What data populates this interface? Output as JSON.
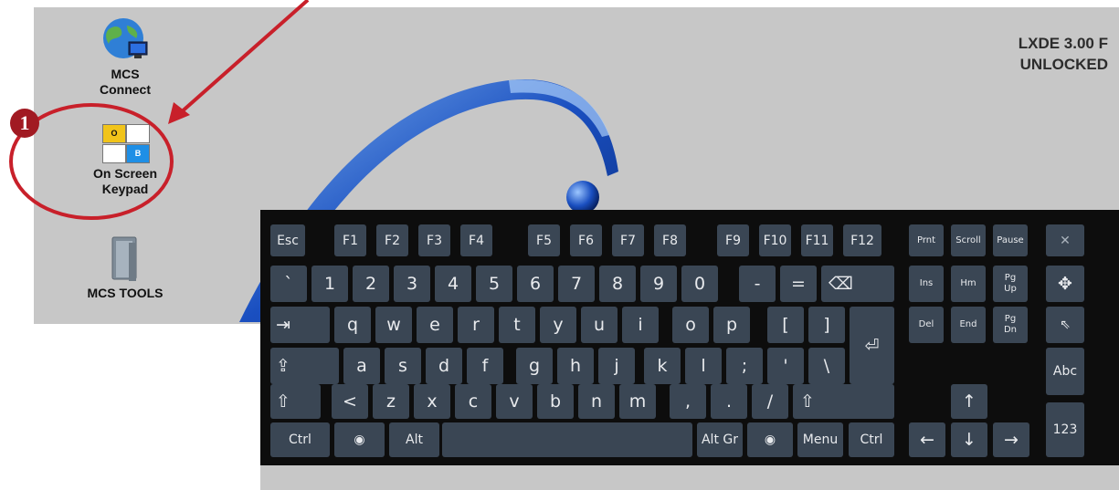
{
  "desktop": {
    "os_info": [
      "LXDE 3.00 F",
      "UNLOCKED"
    ],
    "icons": [
      {
        "id": "mcs-connect",
        "label_lines": [
          "MCS",
          "Connect"
        ],
        "icon": "globe-monitor-icon"
      },
      {
        "id": "on-screen-keypad",
        "label_lines": [
          "On Screen",
          "Keypad"
        ],
        "icon": "keypad-grid-icon",
        "grid_letters": [
          "O",
          "B"
        ]
      },
      {
        "id": "mcs-tools",
        "label_lines": [
          "MCS TOOLS"
        ],
        "icon": "folder-tools-icon"
      }
    ]
  },
  "annotation": {
    "badge": "1",
    "color": "#c8202a"
  },
  "keyboard": {
    "colors": {
      "key": "#3a4654",
      "background": "#0d0d0d",
      "text": "#e8eaed"
    },
    "keys": {
      "esc": "Esc",
      "f1": "F1",
      "f2": "F2",
      "f3": "F3",
      "f4": "F4",
      "f5": "F5",
      "f6": "F6",
      "f7": "F7",
      "f8": "F8",
      "f9": "F9",
      "f10": "F10",
      "f11": "F11",
      "f12": "F12",
      "prnt": "Prnt",
      "scroll": "Scroll",
      "pause": "Pause",
      "close": "✕",
      "backtick": "`",
      "n1": "1",
      "n2": "2",
      "n3": "3",
      "n4": "4",
      "n5": "5",
      "n6": "6",
      "n7": "7",
      "n8": "8",
      "n9": "9",
      "n0": "0",
      "minus": "-",
      "equals": "=",
      "backspace": "⌫",
      "ins": "Ins",
      "hm": "Hm",
      "pgup": "Pg\nUp",
      "move": "✥",
      "tab": "⇥",
      "q": "q",
      "w": "w",
      "e": "e",
      "r": "r",
      "t": "t",
      "y": "y",
      "u": "u",
      "i": "i",
      "o": "o",
      "p": "p",
      "lbracket": "[",
      "rbracket": "]",
      "enter": "⏎",
      "del": "Del",
      "end": "End",
      "pgdn": "Pg\nDn",
      "pointer": "⇖",
      "caps": "⇪",
      "a": "a",
      "s": "s",
      "d": "d",
      "f": "f",
      "g": "g",
      "h": "h",
      "j": "j",
      "k": "k",
      "l": "l",
      "semicolon": ";",
      "quote": "'",
      "backslash": "\\",
      "abc": "Abc",
      "lshift": "⇧",
      "less": "<",
      "z": "z",
      "x": "x",
      "c": "c",
      "v": "v",
      "b": "b",
      "n": "n",
      "m": "m",
      "comma": ",",
      "period": ".",
      "slash": "/",
      "rshift": "⇧",
      "up": "↑",
      "lctrl": "Ctrl",
      "lsuper": "◉",
      "alt": "Alt",
      "space": "",
      "altgr": "Alt Gr",
      "rsuper": "◉",
      "menu": "Menu",
      "rctrl": "Ctrl",
      "left": "←",
      "down": "↓",
      "right": "→",
      "num123": "123"
    }
  }
}
